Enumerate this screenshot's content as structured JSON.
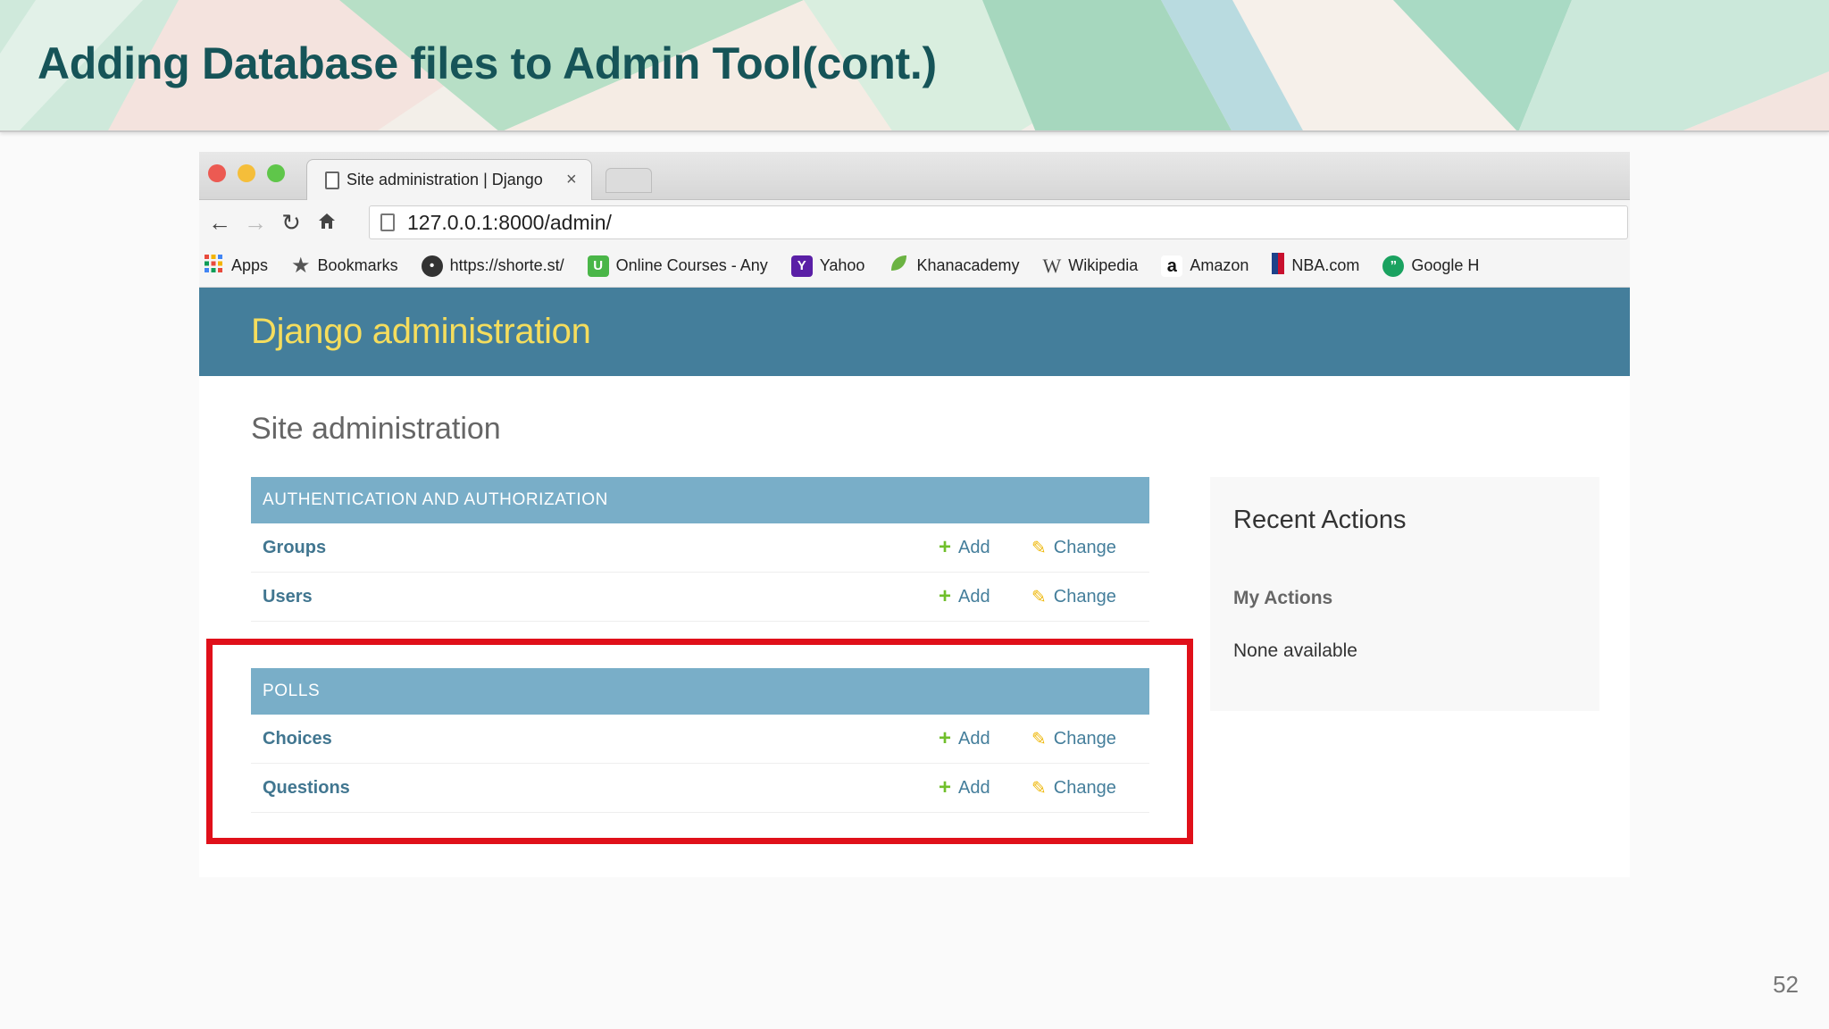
{
  "slide": {
    "title": "Adding Database files to Admin Tool(cont.)",
    "page_number": "52"
  },
  "browser": {
    "tab_title": "Site administration | Django",
    "tab_close": "×",
    "url": "127.0.0.1:8000/admin/",
    "bookmarks": [
      {
        "label": "Apps",
        "icon": "apps-grid-icon",
        "color": "#e84a3c"
      },
      {
        "label": "Bookmarks",
        "icon": "star-icon",
        "color": "#555555"
      },
      {
        "label": "https://shorte.st/",
        "icon": "shortest-logo-icon",
        "color": "#333333"
      },
      {
        "label": "Online Courses - Any",
        "icon": "udemy-logo-icon",
        "color": "#4ab648"
      },
      {
        "label": "Yahoo",
        "icon": "yahoo-logo-icon",
        "color": "#5a1fa6"
      },
      {
        "label": "Khanacademy",
        "icon": "khan-leaf-icon",
        "color": "#6bb342"
      },
      {
        "label": "Wikipedia",
        "icon": "wikipedia-logo-icon",
        "color": "#444444"
      },
      {
        "label": "Amazon",
        "icon": "amazon-logo-icon",
        "color": "#222222"
      },
      {
        "label": "NBA.com",
        "icon": "nba-logo-icon",
        "color": "#c8102e"
      },
      {
        "label": "Google H",
        "icon": "hangouts-icon",
        "color": "#1aa260"
      }
    ]
  },
  "admin": {
    "brand": "Django administration",
    "site_title": "Site administration",
    "modules": [
      {
        "caption": "AUTHENTICATION AND AUTHORIZATION",
        "rows": [
          {
            "name": "Groups",
            "add": "Add",
            "change": "Change"
          },
          {
            "name": "Users",
            "add": "Add",
            "change": "Change"
          }
        ]
      },
      {
        "caption": "POLLS",
        "rows": [
          {
            "name": "Choices",
            "add": "Add",
            "change": "Change"
          },
          {
            "name": "Questions",
            "add": "Add",
            "change": "Change"
          }
        ]
      }
    ],
    "recent_actions": {
      "title": "Recent Actions",
      "my_actions": "My Actions",
      "none": "None available"
    }
  },
  "colors": {
    "title": "#165458",
    "django_header": "#447e9b",
    "django_brand": "#f5dd5d",
    "module_caption": "#79aec8",
    "link": "#417690",
    "highlight": "#e0101a"
  }
}
